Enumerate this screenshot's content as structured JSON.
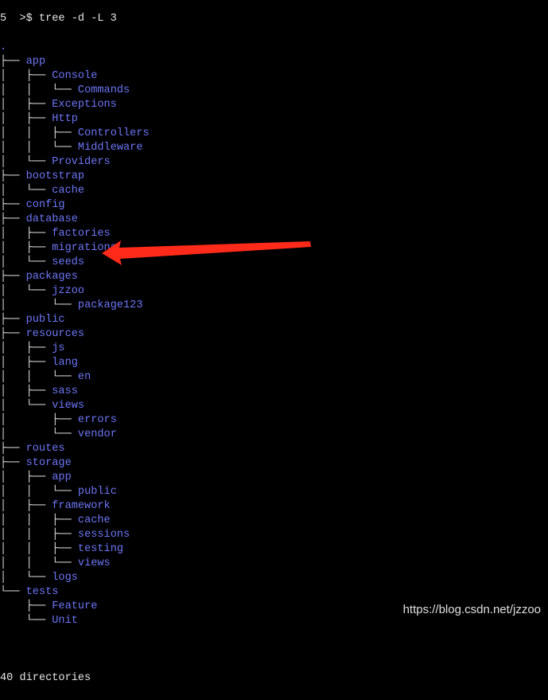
{
  "command": "5  >$ tree -d -L 3",
  "colors": {
    "dir": "#6d76f6",
    "text": "#e6e6e6",
    "arrow": "#ff2a1a",
    "background": "#000000"
  },
  "tree": [
    {
      "prefix": "",
      "name": "."
    },
    {
      "prefix": "├── ",
      "name": "app"
    },
    {
      "prefix": "│   ├── ",
      "name": "Console"
    },
    {
      "prefix": "│   │   └── ",
      "name": "Commands"
    },
    {
      "prefix": "│   ├── ",
      "name": "Exceptions"
    },
    {
      "prefix": "│   ├── ",
      "name": "Http"
    },
    {
      "prefix": "│   │   ├── ",
      "name": "Controllers"
    },
    {
      "prefix": "│   │   └── ",
      "name": "Middleware"
    },
    {
      "prefix": "│   └── ",
      "name": "Providers"
    },
    {
      "prefix": "├── ",
      "name": "bootstrap"
    },
    {
      "prefix": "│   └── ",
      "name": "cache"
    },
    {
      "prefix": "├── ",
      "name": "config"
    },
    {
      "prefix": "├── ",
      "name": "database"
    },
    {
      "prefix": "│   ├── ",
      "name": "factories"
    },
    {
      "prefix": "│   ├── ",
      "name": "migrations"
    },
    {
      "prefix": "│   └── ",
      "name": "seeds"
    },
    {
      "prefix": "├── ",
      "name": "packages"
    },
    {
      "prefix": "│   └── ",
      "name": "jzzoo"
    },
    {
      "prefix": "│       └── ",
      "name": "package123"
    },
    {
      "prefix": "├── ",
      "name": "public"
    },
    {
      "prefix": "├── ",
      "name": "resources"
    },
    {
      "prefix": "│   ├── ",
      "name": "js"
    },
    {
      "prefix": "│   ├── ",
      "name": "lang"
    },
    {
      "prefix": "│   │   └── ",
      "name": "en"
    },
    {
      "prefix": "│   ├── ",
      "name": "sass"
    },
    {
      "prefix": "│   └── ",
      "name": "views"
    },
    {
      "prefix": "│       ├── ",
      "name": "errors"
    },
    {
      "prefix": "│       └── ",
      "name": "vendor"
    },
    {
      "prefix": "├── ",
      "name": "routes"
    },
    {
      "prefix": "├── ",
      "name": "storage"
    },
    {
      "prefix": "│   ├── ",
      "name": "app"
    },
    {
      "prefix": "│   │   └── ",
      "name": "public"
    },
    {
      "prefix": "│   ├── ",
      "name": "framework"
    },
    {
      "prefix": "│   │   ├── ",
      "name": "cache"
    },
    {
      "prefix": "│   │   ├── ",
      "name": "sessions"
    },
    {
      "prefix": "│   │   ├── ",
      "name": "testing"
    },
    {
      "prefix": "│   │   └── ",
      "name": "views"
    },
    {
      "prefix": "│   └── ",
      "name": "logs"
    },
    {
      "prefix": "└── ",
      "name": "tests"
    },
    {
      "prefix": "    ├── ",
      "name": "Feature"
    },
    {
      "prefix": "    └── ",
      "name": "Unit"
    }
  ],
  "summary": "40 directories",
  "watermark": "https://blog.csdn.net/jzzoo",
  "annotation": {
    "icon": "red-arrow-icon",
    "points_to": "packages"
  }
}
